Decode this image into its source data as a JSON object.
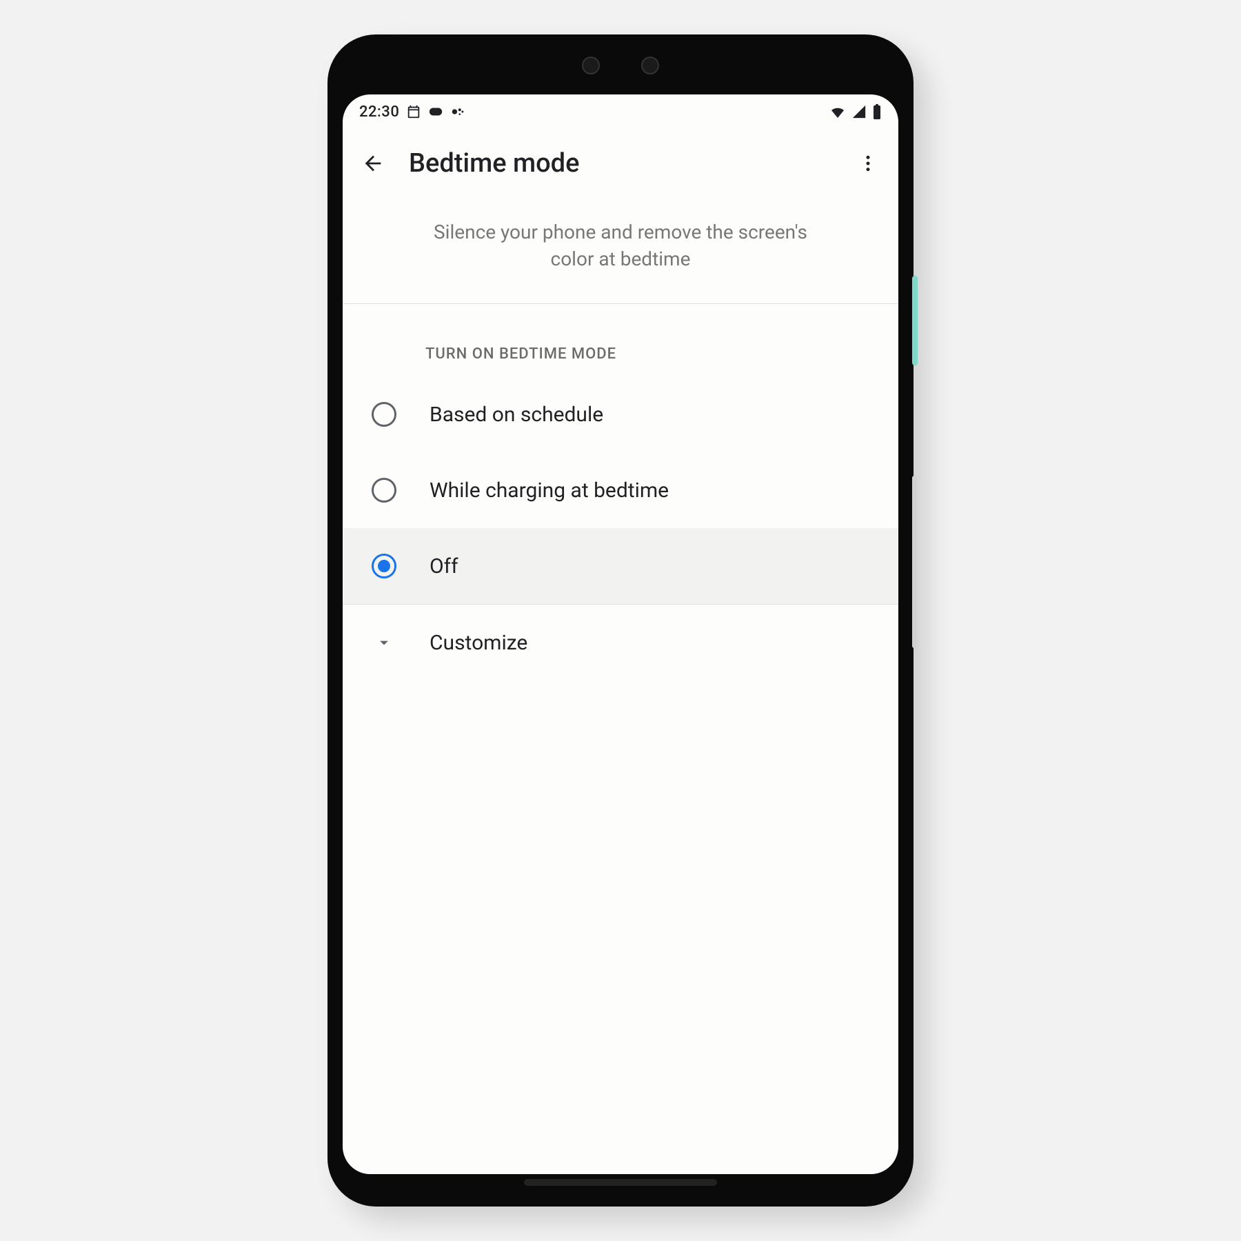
{
  "status_bar": {
    "time": "22:30"
  },
  "app_bar": {
    "title": "Bedtime mode"
  },
  "description": "Silence your phone and remove the screen's color at bedtime",
  "section_header": "TURN ON BEDTIME MODE",
  "options": [
    {
      "label": "Based on schedule",
      "selected": false
    },
    {
      "label": "While charging at bedtime",
      "selected": false
    },
    {
      "label": "Off",
      "selected": true
    }
  ],
  "customize_label": "Customize"
}
